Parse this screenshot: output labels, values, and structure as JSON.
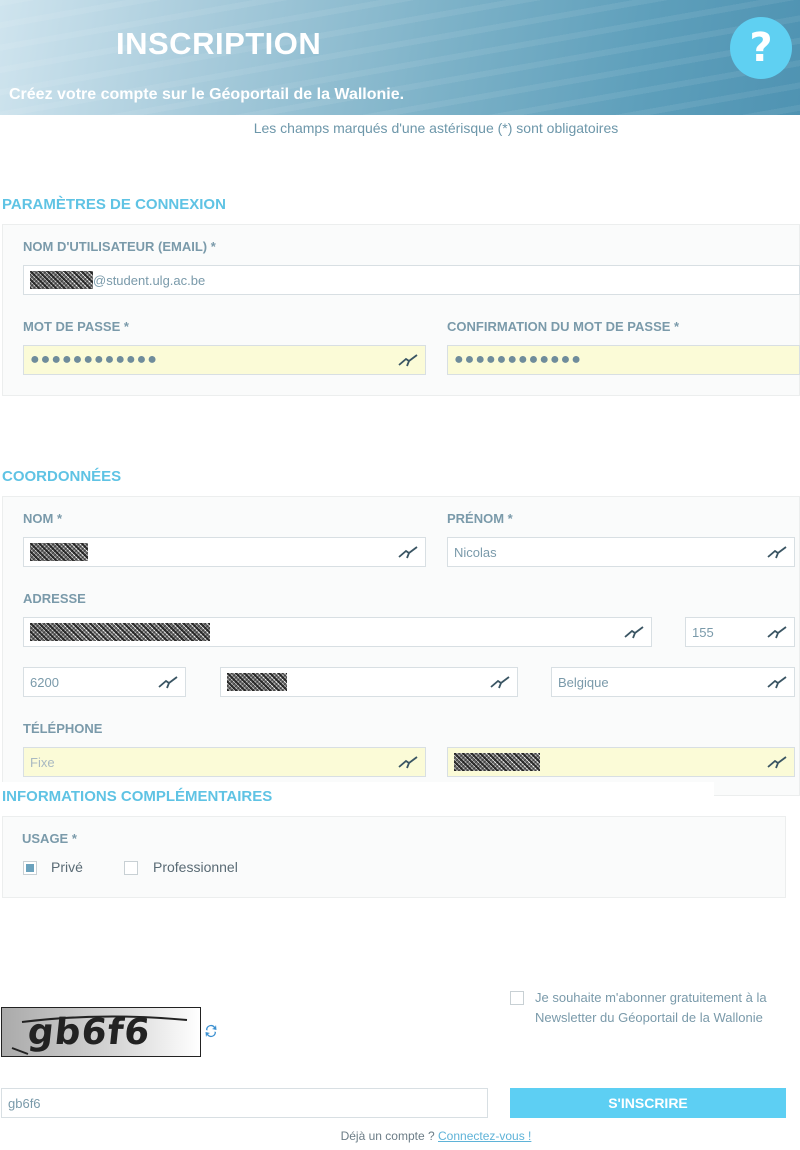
{
  "header": {
    "title": "INSCRIPTION",
    "subtitle": "Créez votre compte sur le Géoportail de la Wallonie.",
    "help_label": "?"
  },
  "required_note": "Les champs marqués d'une astérisque (*) sont obligatoires",
  "connexion": {
    "title": "PARAMÈTRES DE CONNEXION",
    "email_label": "NOM D'UTILISATEUR (EMAIL) *",
    "email_value": "@student.ulg.ac.be",
    "password_label": "MOT DE PASSE *",
    "password_value": "●●●●●●●●●●●●",
    "confirm_label": "CONFIRMATION DU MOT DE PASSE *",
    "confirm_value": "●●●●●●●●●●●●"
  },
  "coordonnees": {
    "title": "COORDONNÉES",
    "nom_label": "NOM *",
    "prenom_label": "PRÉNOM *",
    "prenom_value": "Nicolas",
    "adresse_label": "ADRESSE",
    "number_value": "155",
    "postal_value": "6200",
    "country_value": "Belgique",
    "telephone_label": "TÉLÉPHONE",
    "fixe_placeholder": "Fixe"
  },
  "infos": {
    "title": "INFORMATIONS COMPLÉMENTAIRES",
    "usage_label": "USAGE *",
    "prive_label": "Privé",
    "professionnel_label": "Professionnel"
  },
  "captcha": {
    "image_text": "gb6f6",
    "input_value": "gb6f6"
  },
  "newsletter": {
    "label": "Je souhaite m'abonner gratuitement à la Newsletter du Géoportail de la Wallonie"
  },
  "submit_label": "S'INSCRIRE",
  "footer": {
    "text": "Déjà un compte ?",
    "link": "Connectez-vous !"
  },
  "colors": {
    "accent": "#5dcff3",
    "section_title": "#5fc3e4",
    "autofill": "#fbfbd7"
  }
}
